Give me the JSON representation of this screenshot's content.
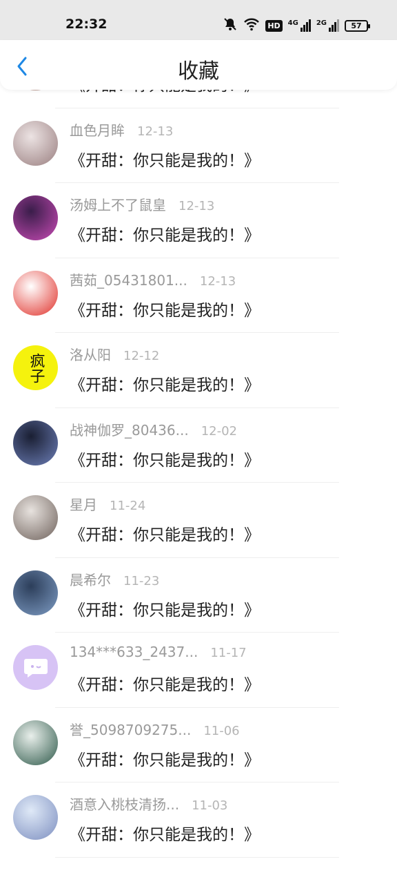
{
  "status_bar": {
    "time": "22:32",
    "icons": [
      "mute-icon",
      "wifi-icon",
      "hd-icon",
      "signal-4g-icon",
      "signal-2g-icon",
      "battery-icon"
    ],
    "hd_label": "HD",
    "net1_label": "4G",
    "net2_label": "2G",
    "battery_level": "57"
  },
  "header": {
    "title": "收藏",
    "back_icon": "chevron-left-icon",
    "accent_color": "#1e88e5"
  },
  "items": [
    {
      "name": "",
      "date": "",
      "title": "《开甜：你只能是我的！》",
      "avatar_colors": [
        "#f2e6df",
        "#b48f86"
      ]
    },
    {
      "name": "血色月眸",
      "date": "12-13",
      "title": "《开甜：你只能是我的！》",
      "avatar_colors": [
        "#ece3e3",
        "#9a7f80"
      ]
    },
    {
      "name": "汤姆上不了鼠皇",
      "date": "12-13",
      "title": "《开甜：你只能是我的！》",
      "avatar_colors": [
        "#3a1d4a",
        "#c84bb5"
      ]
    },
    {
      "name": "茜茹_05431801...",
      "date": "12-13",
      "title": "《开甜：你只能是我的！》",
      "avatar_colors": [
        "#ffffff",
        "#e0312a"
      ]
    },
    {
      "name": "洛从阳",
      "date": "12-12",
      "title": "《开甜：你只能是我的！》",
      "avatar_colors": [
        "#f5f20d",
        "#f5f20d"
      ],
      "avatar_text": "疯子"
    },
    {
      "name": "战神伽罗_80436...",
      "date": "12-02",
      "title": "《开甜：你只能是我的！》",
      "avatar_colors": [
        "#1a1f33",
        "#6d7fb8"
      ]
    },
    {
      "name": "星月",
      "date": "11-24",
      "title": "《开甜：你只能是我的！》",
      "avatar_colors": [
        "#e7e2de",
        "#6f625c"
      ]
    },
    {
      "name": "晨希尔",
      "date": "11-23",
      "title": "《开甜：你只能是我的！》",
      "avatar_colors": [
        "#2c3e5a",
        "#7e9cc4"
      ]
    },
    {
      "name": "134***633_2437...",
      "date": "11-17",
      "title": "《开甜：你只能是我的！》",
      "avatar_colors": [
        "#d7c3f5",
        "#d7c3f5"
      ],
      "avatar_icon": "chat-bubble-icon"
    },
    {
      "name": "誉_5098709275...",
      "date": "11-06",
      "title": "《开甜：你只能是我的！》",
      "avatar_colors": [
        "#e9efeb",
        "#2f5a4b"
      ]
    },
    {
      "name": "酒意入桃枝清扬...",
      "date": "11-03",
      "title": "《开甜：你只能是我的！》",
      "avatar_colors": [
        "#dfe9f7",
        "#7d8fc0"
      ]
    }
  ]
}
